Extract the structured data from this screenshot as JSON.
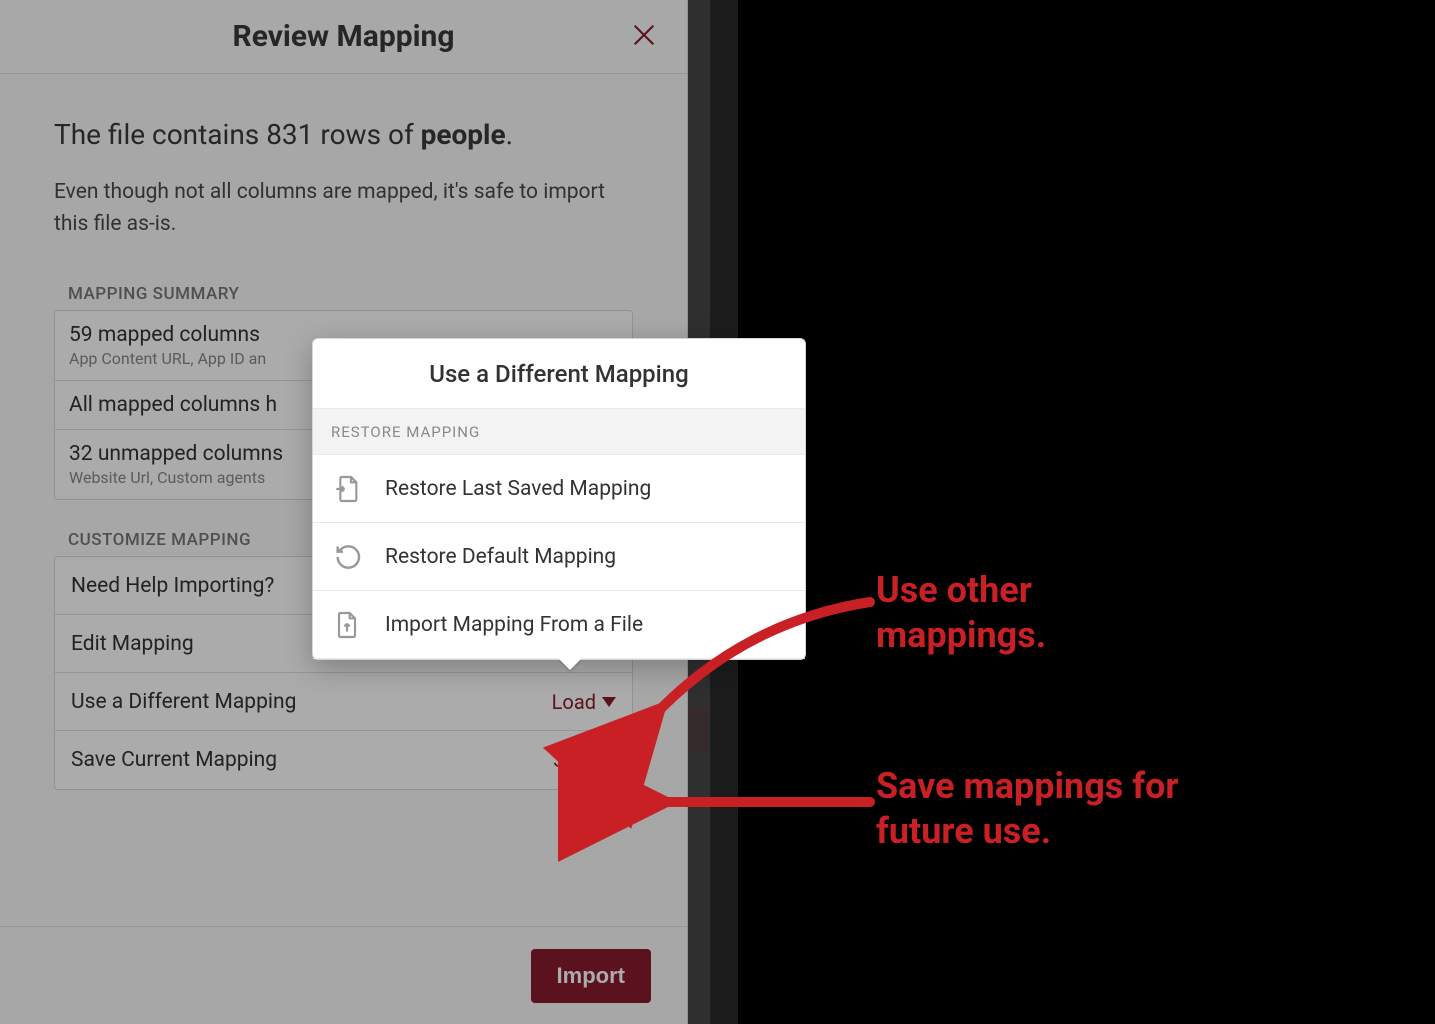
{
  "dialog": {
    "title": "Review Mapping",
    "summary_prefix": "The file contains ",
    "row_count": "831",
    "summary_middle": " rows of ",
    "entity": "people",
    "summary_suffix": ".",
    "subtext": "Even though not all columns are mapped, it's safe to import this file as-is.",
    "mapping_summary_label": "Mapping Summary",
    "mapped": {
      "primary": "59 mapped columns",
      "secondary": "App Content URL, App ID an"
    },
    "all_mapped": {
      "primary": "All mapped columns h"
    },
    "unmapped": {
      "primary": "32 unmapped columns",
      "secondary": "Website Url, Custom agents"
    },
    "customize_label": "Customize Mapping",
    "customize_items": {
      "help": "Need Help Importing?",
      "edit": "Edit Mapping",
      "load_label": "Use a Different Mapping",
      "load_action": "Load",
      "save_label": "Save Current Mapping",
      "save_action": "Save"
    },
    "import_button": "Import"
  },
  "popover": {
    "title": "Use a Different Mapping",
    "section": "RESTORE MAPPING",
    "items": {
      "restore_last": "Restore Last Saved Mapping",
      "restore_default": "Restore Default Mapping",
      "import_file": "Import Mapping From a File"
    }
  },
  "callouts": {
    "use_other": "Use other mappings.",
    "save_future": "Save mappings for future use."
  }
}
